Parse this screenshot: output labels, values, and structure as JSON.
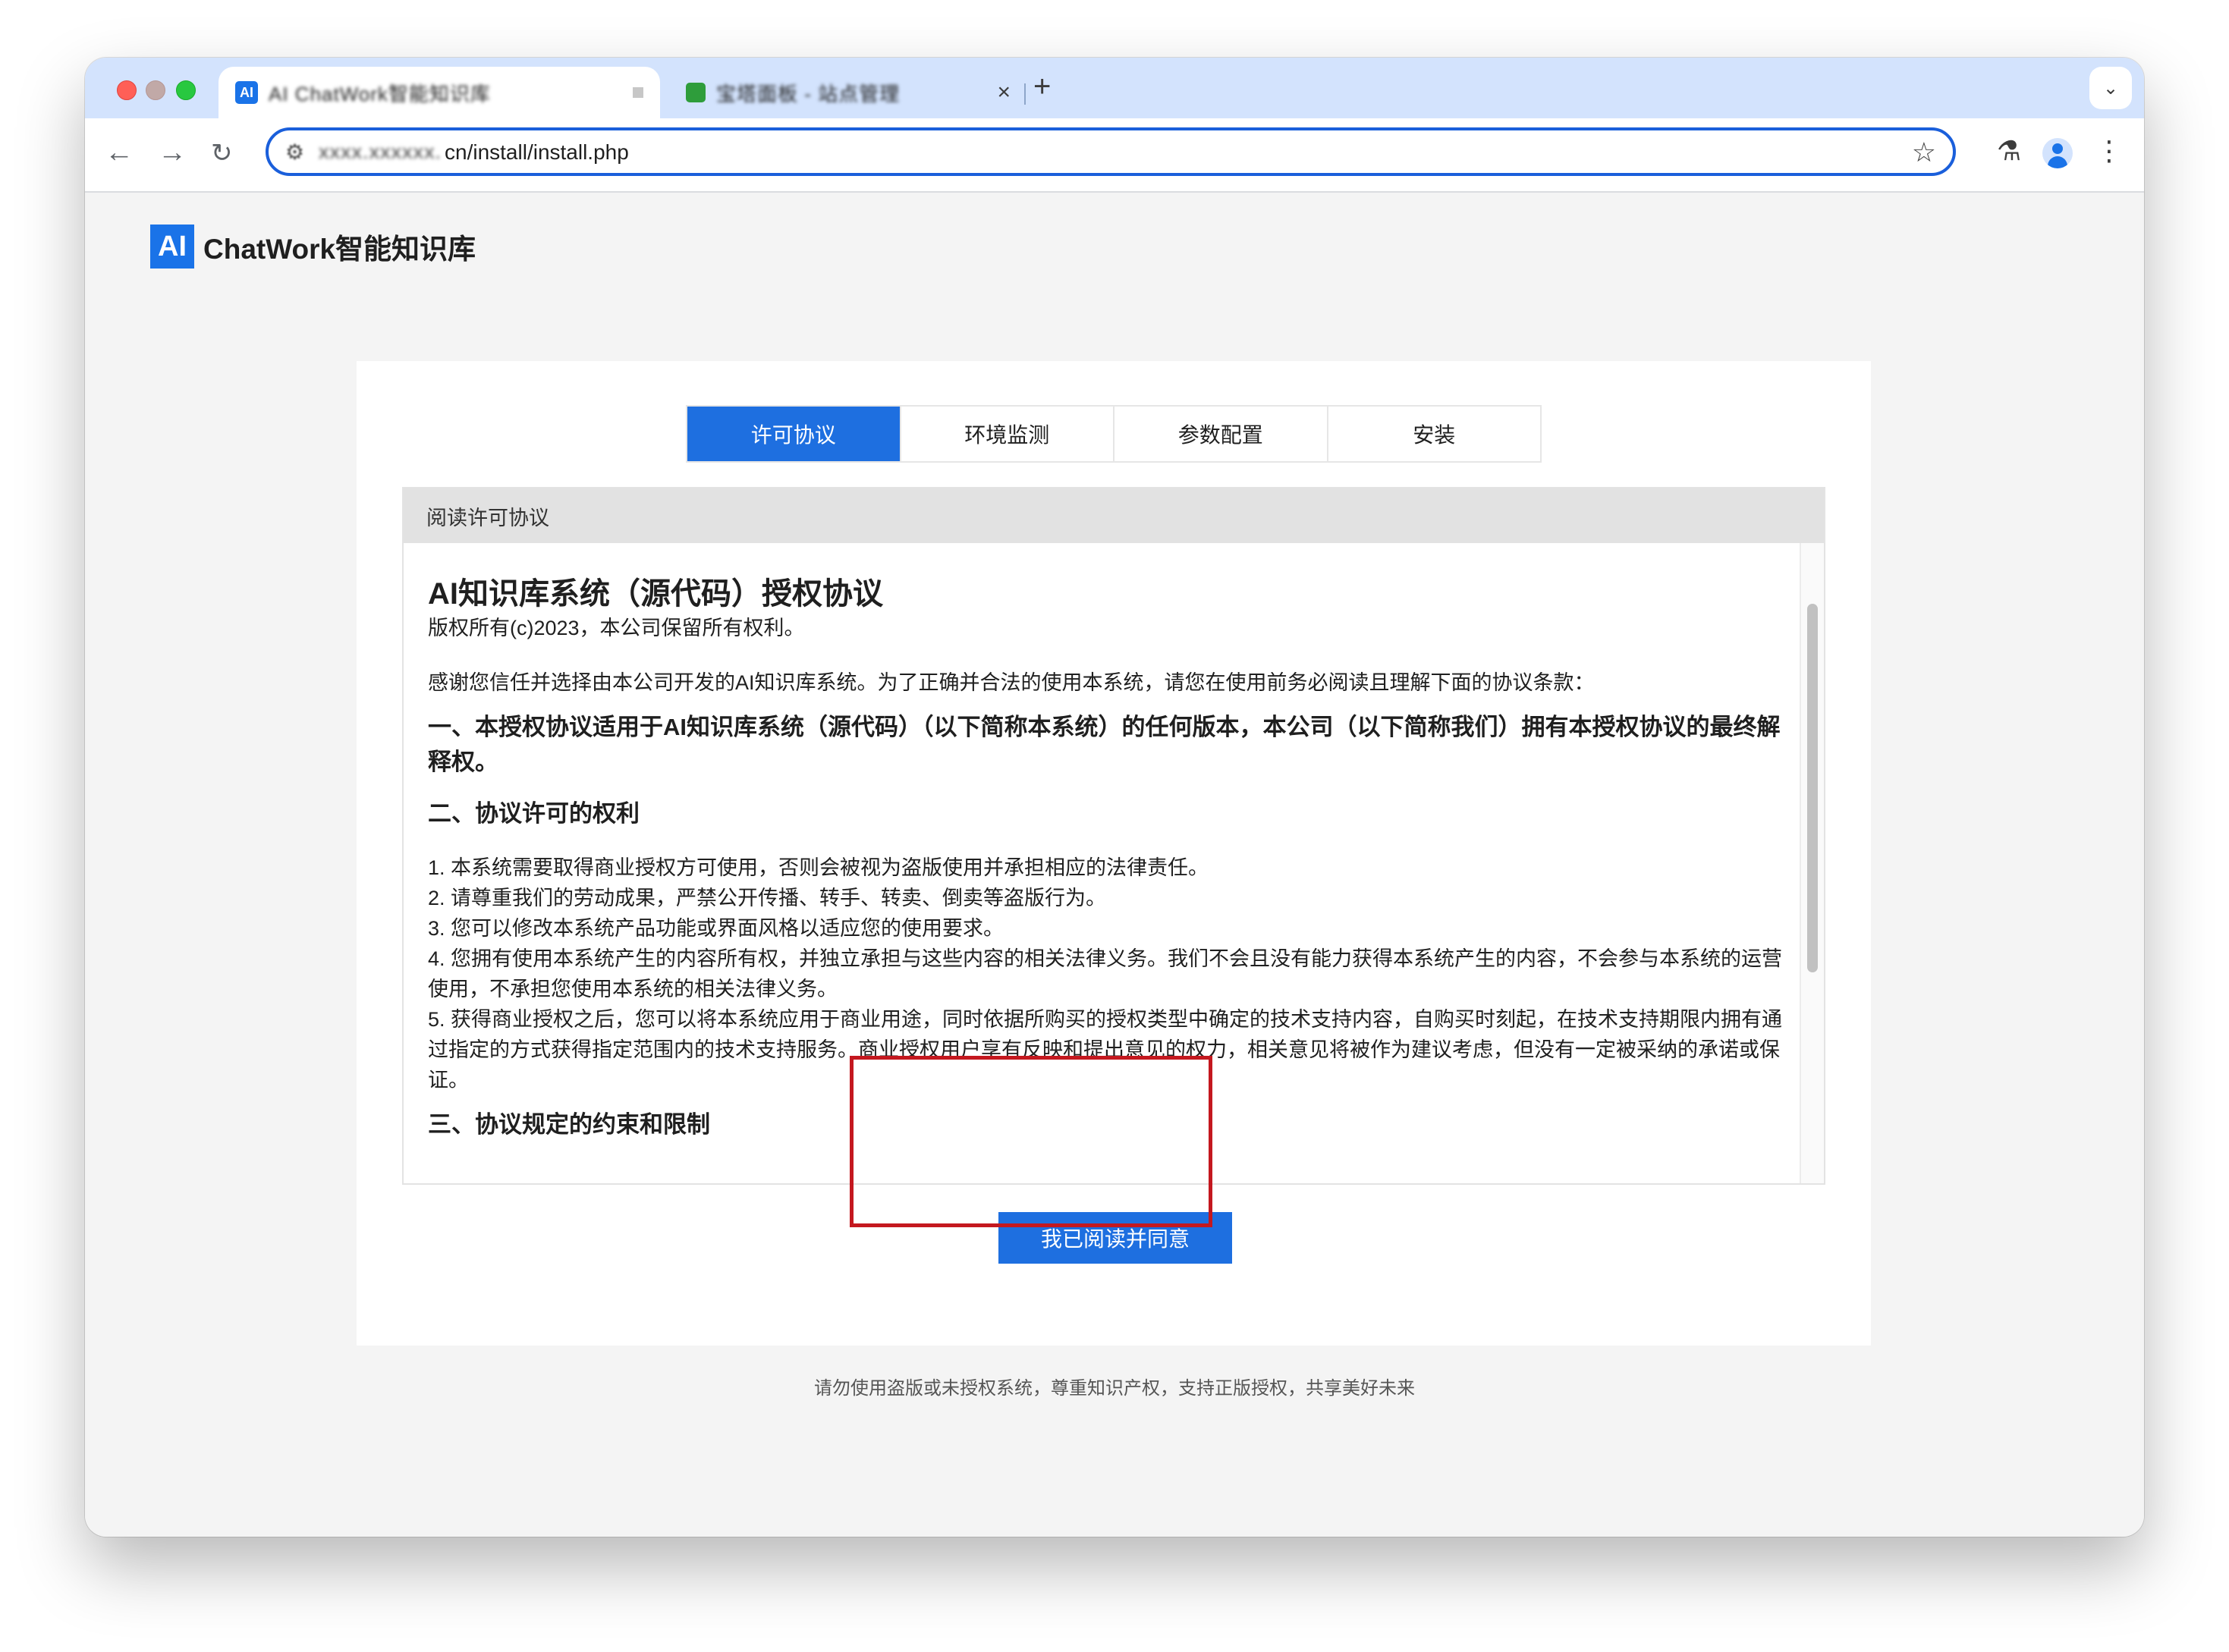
{
  "browser": {
    "tabs": [
      {
        "title": "AI ChatWork智能知识库",
        "favicon": "ai-logo-icon",
        "active": true
      },
      {
        "title": "宝塔面板 - 站点管理",
        "favicon": "green-square-icon",
        "active": false
      }
    ],
    "new_tab_label": "+",
    "close_label": "×",
    "url_blurred": "xxxx.xxxxxx.",
    "url_visible": "cn/install/install.php"
  },
  "app": {
    "logo_mark": "AI",
    "logo_text": "ChatWork智能知识库"
  },
  "steps": [
    {
      "label": "许可协议",
      "active": true
    },
    {
      "label": "环境监测",
      "active": false
    },
    {
      "label": "参数配置",
      "active": false
    },
    {
      "label": "安装",
      "active": false
    }
  ],
  "panel": {
    "header": "阅读许可协议",
    "doc_title": "AI知识库系统（源代码）授权协议",
    "copyright": "版权所有(c)2023，本公司保留所有权利。",
    "intro": "感谢您信任并选择由本公司开发的AI知识库系统。为了正确并合法的使用本系统，请您在使用前务必阅读且理解下面的协议条款：",
    "section1": "一、本授权协议适用于AI知识库系统（源代码）（以下简称本系统）的任何版本，本公司（以下简称我们）拥有本授权协议的最终解释权。",
    "section2": "二、协议许可的权利",
    "items": [
      "1. 本系统需要取得商业授权方可使用，否则会被视为盗版使用并承担相应的法律责任。",
      "2. 请尊重我们的劳动成果，严禁公开传播、转手、转卖、倒卖等盗版行为。",
      "3. 您可以修改本系统产品功能或界面风格以适应您的使用要求。",
      "4. 您拥有使用本系统产生的内容所有权，并独立承担与这些内容的相关法律义务。我们不会且没有能力获得本系统产生的内容，不会参与本系统的运营使用，不承担您使用本系统的相关法律义务。",
      "5. 获得商业授权之后，您可以将本系统应用于商业用途，同时依据所购买的授权类型中确定的技术支持内容，自购买时刻起，在技术支持期限内拥有通过指定的方式获得指定范围内的技术支持服务。商业授权用户享有反映和提出意见的权力，相关意见将被作为建议考虑，但没有一定被采纳的承诺或保证。"
    ],
    "section3": "三、协议规定的约束和限制"
  },
  "agree_button": "我已阅读并同意",
  "footer": "请勿使用盗版或未授权系统，尊重知识产权，支持正版授权，共享美好未来",
  "colors": {
    "primary": "#1e6fe0",
    "highlight": "#c4181f",
    "tabstrip": "#d3e3fd"
  }
}
